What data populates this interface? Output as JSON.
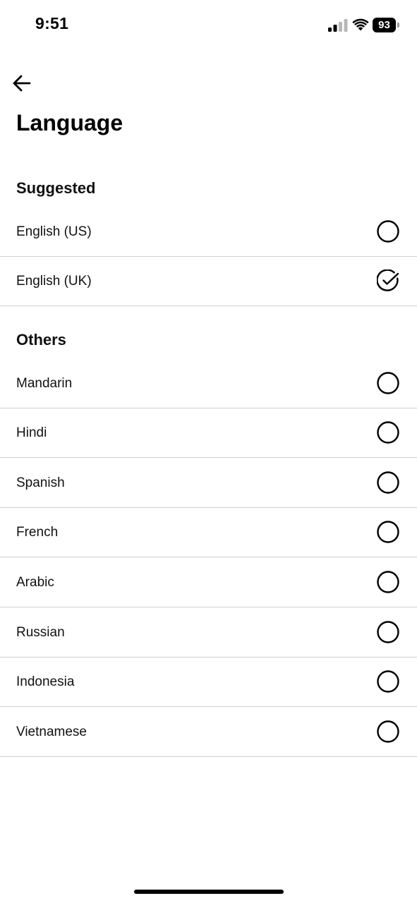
{
  "status_bar": {
    "time": "9:51",
    "battery_level": "93",
    "signal_icon": "cellular-signal-icon",
    "wifi_icon": "wifi-icon",
    "battery_icon": "battery-icon"
  },
  "header": {
    "back_icon": "arrow-left-icon",
    "title": "Language"
  },
  "sections": [
    {
      "heading": "Suggested",
      "items": [
        {
          "label": "English (US)",
          "selected": false
        },
        {
          "label": "English (UK)",
          "selected": true
        }
      ]
    },
    {
      "heading": "Others",
      "items": [
        {
          "label": "Mandarin",
          "selected": false
        },
        {
          "label": "Hindi",
          "selected": false
        },
        {
          "label": "Spanish",
          "selected": false
        },
        {
          "label": "French",
          "selected": false
        },
        {
          "label": "Arabic",
          "selected": false
        },
        {
          "label": "Russian",
          "selected": false
        },
        {
          "label": "Indonesia",
          "selected": false
        },
        {
          "label": "Vietnamese",
          "selected": false
        }
      ]
    }
  ],
  "colors": {
    "background": "#ffffff",
    "text": "#111111",
    "divider": "#cfcfcf"
  }
}
